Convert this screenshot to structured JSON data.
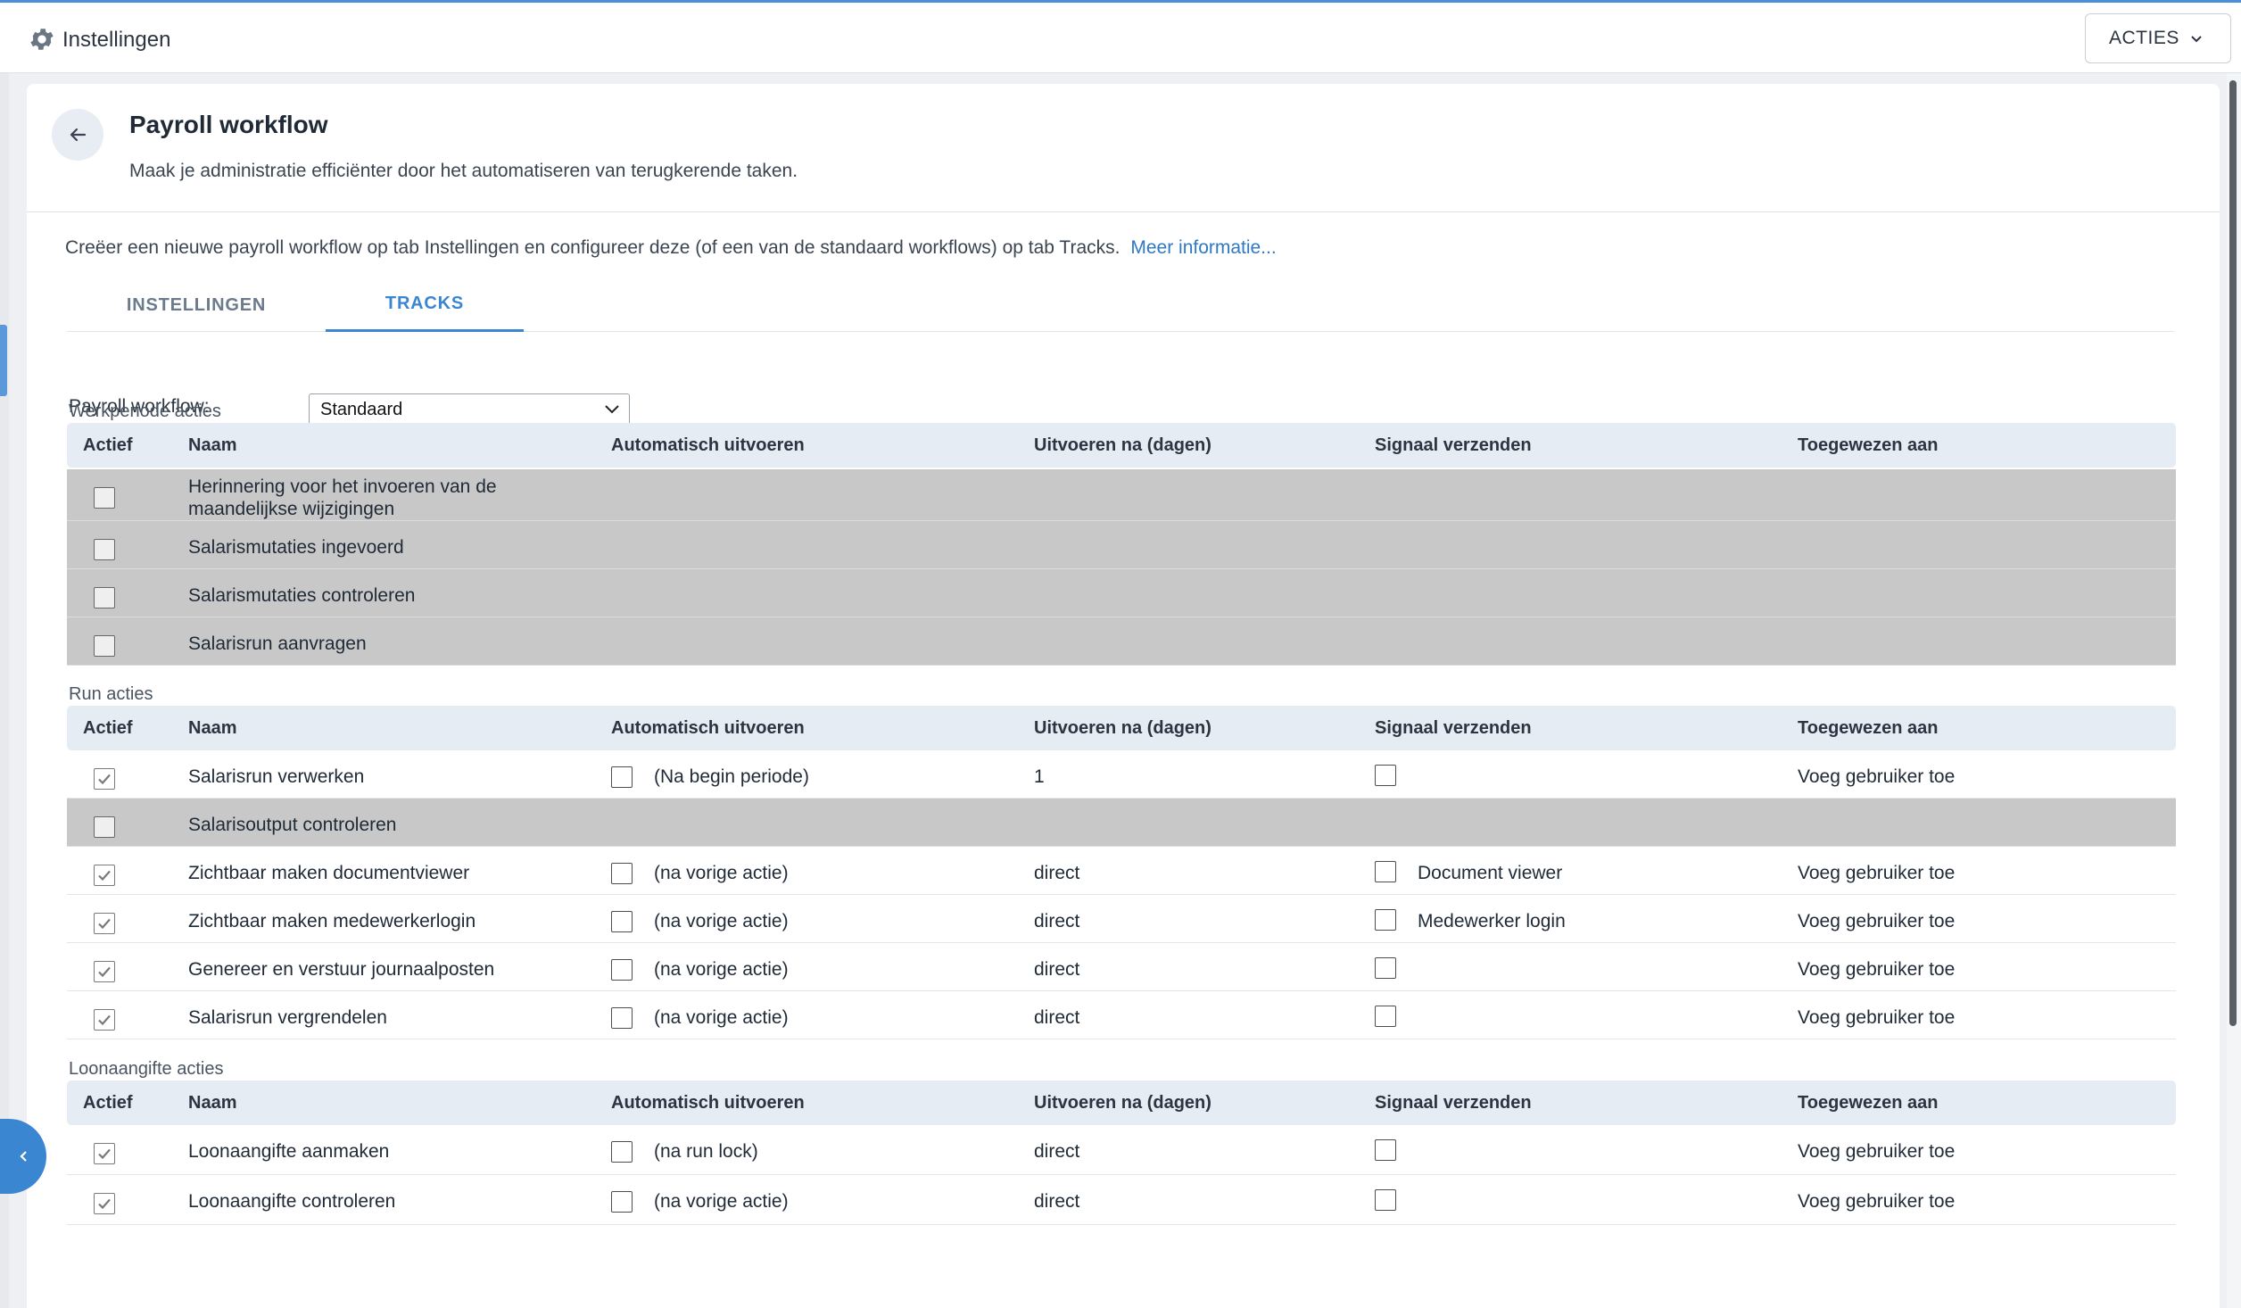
{
  "topbar": {
    "title": "Instellingen",
    "actions_label": "ACTIES"
  },
  "header": {
    "title": "Payroll workflow",
    "subtitle": "Maak je administratie efficiënter door het automatiseren van terugkerende taken."
  },
  "info": {
    "text": "Creëer een nieuwe payroll workflow op tab Instellingen en configureer deze (of een van de standaard workflows) op tab Tracks.",
    "link": "Meer informatie..."
  },
  "tabs": [
    {
      "label": "INSTELLINGEN",
      "active": false
    },
    {
      "label": "TRACKS",
      "active": true
    }
  ],
  "workflow": {
    "label": "Payroll workflow:",
    "selected": "Standaard"
  },
  "columns": [
    "Actief",
    "Naam",
    "Automatisch uitvoeren",
    "Uitvoeren na (dagen)",
    "Signaal verzenden",
    "Toegewezen aan"
  ],
  "colors": {
    "accent": "#3b86d1",
    "header_bg": "#e6ecf3",
    "disabled_row": "#c8c8c8"
  },
  "sections": [
    {
      "title": "Werkperiode acties",
      "rows": [
        {
          "active": false,
          "name": "Herinnering voor het invoeren van de",
          "name2": "maandelijkse wijzigingen"
        },
        {
          "active": false,
          "name": "Salarismutaties ingevoerd"
        },
        {
          "active": false,
          "name": "Salarismutaties controleren"
        },
        {
          "active": false,
          "name": "Salarisrun aanvragen"
        }
      ]
    },
    {
      "title": "Run acties",
      "rows": [
        {
          "active": true,
          "name": "Salarisrun verwerken",
          "auto": false,
          "auto_label": "(Na begin periode)",
          "days": "1",
          "signal": false,
          "signal_label": "",
          "assigned": "Voeg gebruiker toe"
        },
        {
          "active": false,
          "name": "Salarisoutput controleren"
        },
        {
          "active": true,
          "name": "Zichtbaar maken documentviewer",
          "auto": false,
          "auto_label": "(na vorige actie)",
          "days": "direct",
          "signal": false,
          "signal_label": "Document viewer",
          "assigned": "Voeg gebruiker toe"
        },
        {
          "active": true,
          "name": "Zichtbaar maken medewerkerlogin",
          "auto": false,
          "auto_label": "(na vorige actie)",
          "days": "direct",
          "signal": false,
          "signal_label": "Medewerker login",
          "assigned": "Voeg gebruiker toe"
        },
        {
          "active": true,
          "name": "Genereer en verstuur journaalposten",
          "auto": false,
          "auto_label": "(na vorige actie)",
          "days": "direct",
          "signal": false,
          "signal_label": "",
          "assigned": "Voeg gebruiker toe"
        },
        {
          "active": true,
          "name": "Salarisrun vergrendelen",
          "auto": false,
          "auto_label": "(na vorige actie)",
          "days": "direct",
          "signal": false,
          "signal_label": "",
          "assigned": "Voeg gebruiker toe"
        }
      ]
    },
    {
      "title": "Loonaangifte acties",
      "rows": [
        {
          "active": true,
          "name": "Loonaangifte aanmaken",
          "auto": false,
          "auto_label": "(na run lock)",
          "days": "direct",
          "signal": false,
          "signal_label": "",
          "assigned": "Voeg gebruiker toe"
        },
        {
          "active": true,
          "name": "Loonaangifte controleren",
          "auto": false,
          "auto_label": "(na vorige actie)",
          "days": "direct",
          "signal": false,
          "signal_label": "",
          "assigned": "Voeg gebruiker toe"
        }
      ]
    }
  ]
}
